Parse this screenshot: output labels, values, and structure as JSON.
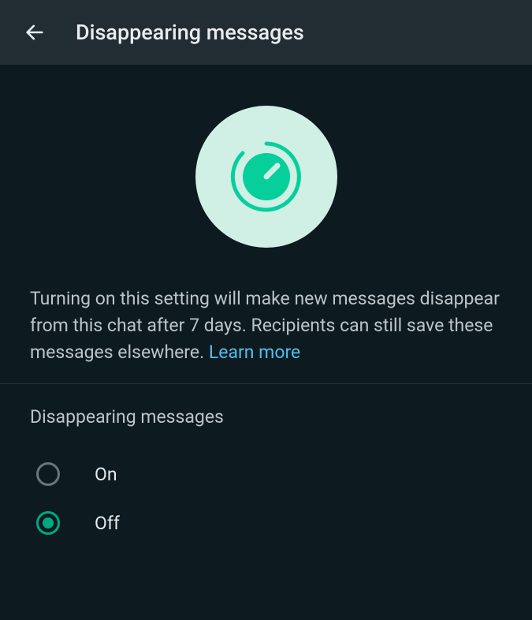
{
  "header": {
    "title": "Disappearing messages"
  },
  "description": {
    "text": "Turning on this setting will make new messages disappear from this chat after 7 days. Recipients can still save these messages elsewhere. ",
    "learn_more": "Learn more"
  },
  "section": {
    "title": "Disappearing messages",
    "options": [
      {
        "label": "On",
        "selected": false
      },
      {
        "label": "Off",
        "selected": true
      }
    ]
  },
  "colors": {
    "accent": "#00a884",
    "link": "#53bdeb",
    "header_bg": "#222d33",
    "body_bg": "#0d1a1f"
  }
}
